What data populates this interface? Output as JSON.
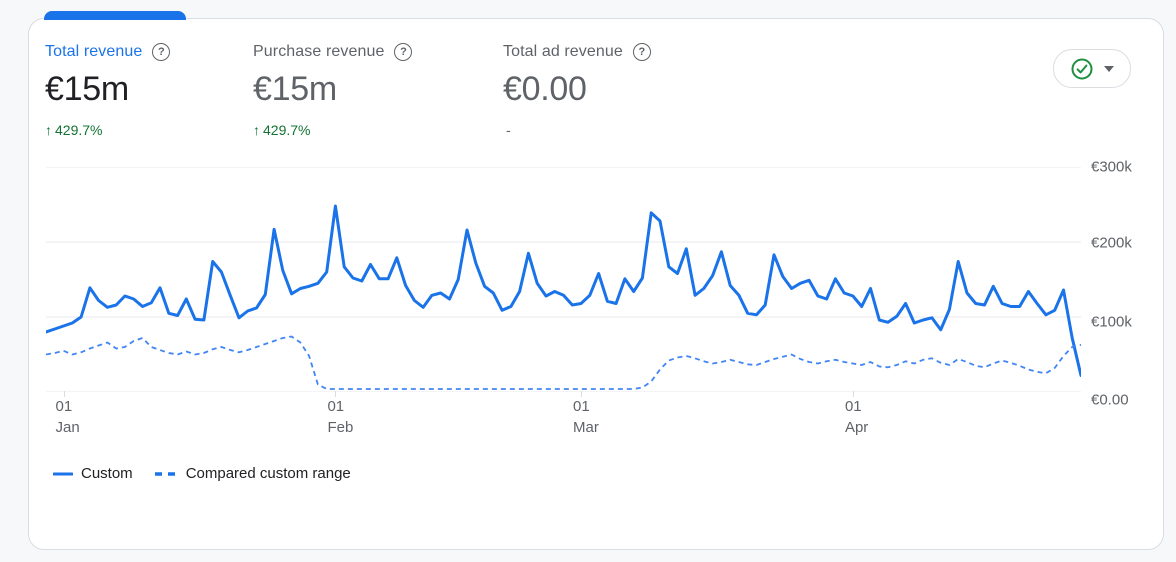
{
  "card": {
    "metrics": [
      {
        "label": "Total revenue",
        "value": "€15m",
        "delta": "429.7%",
        "delta_arrow": "↑",
        "state": "selected"
      },
      {
        "label": "Purchase revenue",
        "value": "€15m",
        "delta": "429.7%",
        "delta_arrow": "↑",
        "state": "normal"
      },
      {
        "label": "Total ad revenue",
        "value": "€0.00",
        "delta": "-",
        "delta_arrow": "",
        "state": "normal"
      }
    ],
    "toolbar": {
      "status_icon": "check-circle-icon",
      "dropdown_icon": "caret-down-icon"
    }
  },
  "legend": [
    {
      "label": "Custom",
      "style": "solid"
    },
    {
      "label": "Compared custom range",
      "style": "dashed"
    }
  ],
  "colors": {
    "accent_blue": "#1a73e8",
    "compare_blue": "#4285f4",
    "positive_green": "#137333",
    "text_dark": "#202124",
    "text_gray": "#5f6368",
    "grid": "#e8eaed",
    "border": "#dadce0",
    "page_background": "#f6f8fa",
    "check_green": "#1e8e3e"
  },
  "chart_data": {
    "type": "line",
    "title": "Total revenue over time",
    "unit": "EUR (values in thousands)",
    "grid": true,
    "legend_position": "bottom-left",
    "ylim": [
      0,
      300
    ],
    "y_ticks": [
      {
        "value": 300,
        "label": "€300k"
      },
      {
        "value": 200,
        "label": "€200k"
      },
      {
        "value": 100,
        "label": "€100k"
      },
      {
        "value": 0,
        "label": "€0.00"
      }
    ],
    "x_ticks": [
      {
        "index": 2,
        "day": "01",
        "month": "Jan"
      },
      {
        "index": 33,
        "day": "01",
        "month": "Feb"
      },
      {
        "index": 61,
        "day": "01",
        "month": "Mar"
      },
      {
        "index": 92,
        "day": "01",
        "month": "Apr"
      }
    ],
    "series": [
      {
        "name": "Custom",
        "style": "solid",
        "color": "#1a73e8",
        "values": [
          80,
          84,
          88,
          92,
          100,
          139,
          122,
          113,
          116,
          128,
          124,
          114,
          119,
          139,
          105,
          102,
          124,
          97,
          96,
          174,
          160,
          129,
          99,
          108,
          112,
          130,
          217,
          162,
          131,
          138,
          141,
          145,
          160,
          248,
          167,
          152,
          148,
          170,
          151,
          151,
          179,
          142,
          122,
          113,
          129,
          132,
          124,
          150,
          216,
          172,
          141,
          132,
          109,
          114,
          134,
          185,
          145,
          128,
          134,
          129,
          116,
          118,
          129,
          158,
          121,
          118,
          151,
          134,
          152,
          239,
          228,
          167,
          158,
          191,
          129,
          138,
          155,
          187,
          142,
          129,
          105,
          103,
          116,
          183,
          154,
          138,
          145,
          149,
          128,
          124,
          151,
          132,
          128,
          114,
          138,
          96,
          93,
          101,
          118,
          92,
          96,
          99,
          83,
          110,
          174,
          132,
          118,
          116,
          141,
          118,
          114,
          114,
          134,
          118,
          103,
          109,
          136,
          72,
          22
        ]
      },
      {
        "name": "Compared custom range",
        "style": "dashed",
        "color": "#4285f4",
        "values": [
          50,
          52,
          55,
          50,
          53,
          58,
          62,
          66,
          58,
          60,
          68,
          72,
          60,
          56,
          52,
          50,
          54,
          50,
          52,
          57,
          60,
          56,
          53,
          56,
          60,
          64,
          68,
          72,
          74,
          66,
          48,
          10,
          4,
          4,
          4,
          4,
          4,
          4,
          4,
          4,
          4,
          4,
          4,
          4,
          4,
          4,
          4,
          4,
          4,
          4,
          4,
          4,
          4,
          4,
          4,
          4,
          4,
          4,
          4,
          4,
          4,
          4,
          4,
          4,
          4,
          4,
          4,
          4,
          6,
          14,
          30,
          42,
          46,
          48,
          45,
          41,
          38,
          40,
          43,
          40,
          37,
          36,
          40,
          44,
          47,
          50,
          44,
          40,
          38,
          41,
          43,
          40,
          38,
          36,
          40,
          34,
          33,
          36,
          41,
          38,
          43,
          45,
          39,
          36,
          44,
          40,
          35,
          33,
          38,
          42,
          39,
          35,
          30,
          27,
          25,
          32,
          48,
          60,
          63
        ]
      }
    ]
  }
}
